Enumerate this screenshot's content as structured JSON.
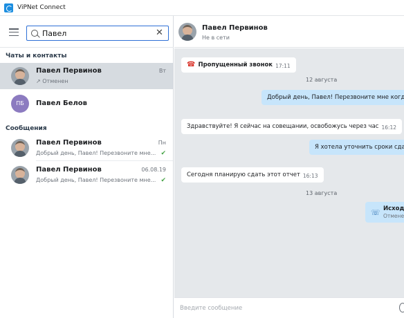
{
  "app": {
    "title": "ViPNet Connect",
    "accent": "#2d6fd6"
  },
  "search": {
    "value": "Павел",
    "placeholder": ""
  },
  "sections": {
    "contacts_title": "Чаты и контакты",
    "messages_title": "Сообщения"
  },
  "contacts": [
    {
      "name": "Павел Первинов",
      "sub": "↗ Отменен",
      "time": "Вт",
      "selected": true
    },
    {
      "name": "Павел Белов",
      "initials": "ПБ"
    }
  ],
  "messages": [
    {
      "name": "Павел Первинов",
      "sub": "Добрый день, Павел! Перезвоните мне...",
      "time": "Пн"
    },
    {
      "name": "Павел Первинов",
      "sub": "Добрый день, Павел! Перезвоните мне...",
      "time": "06.08.19"
    }
  ],
  "chat": {
    "header_name": "Павел Первинов",
    "header_status": "Не в сети",
    "missed_call": {
      "text": "Пропущенный звонок",
      "time": "17:11"
    },
    "date1": "12 августа",
    "out1": "Добрый день, Павел! Перезвоните мне когда см",
    "in1": {
      "text": "Здравствуйте! Я сейчас на совещании, освобожусь через час",
      "time": "16:12"
    },
    "out2": "Я хотела уточнить сроки сдачи",
    "in2": {
      "text": "Сегодня планирую сдать этот отчет",
      "time": "16:13"
    },
    "date2": "13 августа",
    "call_out": {
      "title": "Исходя",
      "status": "Отмене"
    }
  },
  "composer": {
    "placeholder": "Введите сообщение"
  }
}
